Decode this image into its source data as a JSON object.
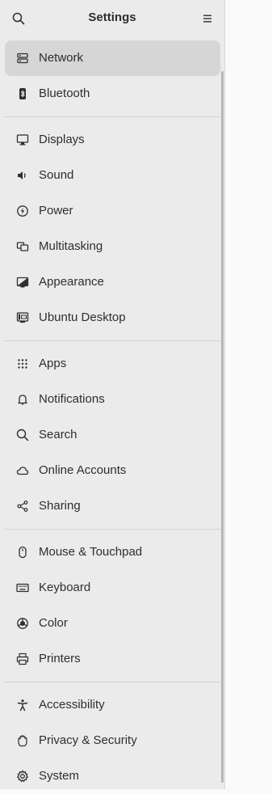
{
  "header": {
    "title": "Settings",
    "search_icon": "search-icon",
    "menu_icon": "menu-icon"
  },
  "sections": [
    [
      {
        "id": "network",
        "label": "Network",
        "icon": "network-icon",
        "selected": true
      },
      {
        "id": "bluetooth",
        "label": "Bluetooth",
        "icon": "bluetooth-icon"
      }
    ],
    [
      {
        "id": "displays",
        "label": "Displays",
        "icon": "display-icon"
      },
      {
        "id": "sound",
        "label": "Sound",
        "icon": "speaker-icon"
      },
      {
        "id": "power",
        "label": "Power",
        "icon": "power-icon"
      },
      {
        "id": "multitasking",
        "label": "Multitasking",
        "icon": "multitasking-icon"
      },
      {
        "id": "appearance",
        "label": "Appearance",
        "icon": "appearance-icon"
      },
      {
        "id": "ubuntu-desktop",
        "label": "Ubuntu Desktop",
        "icon": "ubuntu-desktop-icon"
      }
    ],
    [
      {
        "id": "apps",
        "label": "Apps",
        "icon": "apps-grid-icon"
      },
      {
        "id": "notifications",
        "label": "Notifications",
        "icon": "bell-icon"
      },
      {
        "id": "search",
        "label": "Search",
        "icon": "search-icon"
      },
      {
        "id": "online-accounts",
        "label": "Online Accounts",
        "icon": "cloud-icon"
      },
      {
        "id": "sharing",
        "label": "Sharing",
        "icon": "share-icon"
      }
    ],
    [
      {
        "id": "mouse-touchpad",
        "label": "Mouse & Touchpad",
        "icon": "mouse-icon"
      },
      {
        "id": "keyboard",
        "label": "Keyboard",
        "icon": "keyboard-icon"
      },
      {
        "id": "color",
        "label": "Color",
        "icon": "color-icon"
      },
      {
        "id": "printers",
        "label": "Printers",
        "icon": "printer-icon"
      }
    ],
    [
      {
        "id": "accessibility",
        "label": "Accessibility",
        "icon": "accessibility-icon"
      },
      {
        "id": "privacy-security",
        "label": "Privacy & Security",
        "icon": "hand-icon"
      },
      {
        "id": "system",
        "label": "System",
        "icon": "gear-icon"
      }
    ]
  ]
}
